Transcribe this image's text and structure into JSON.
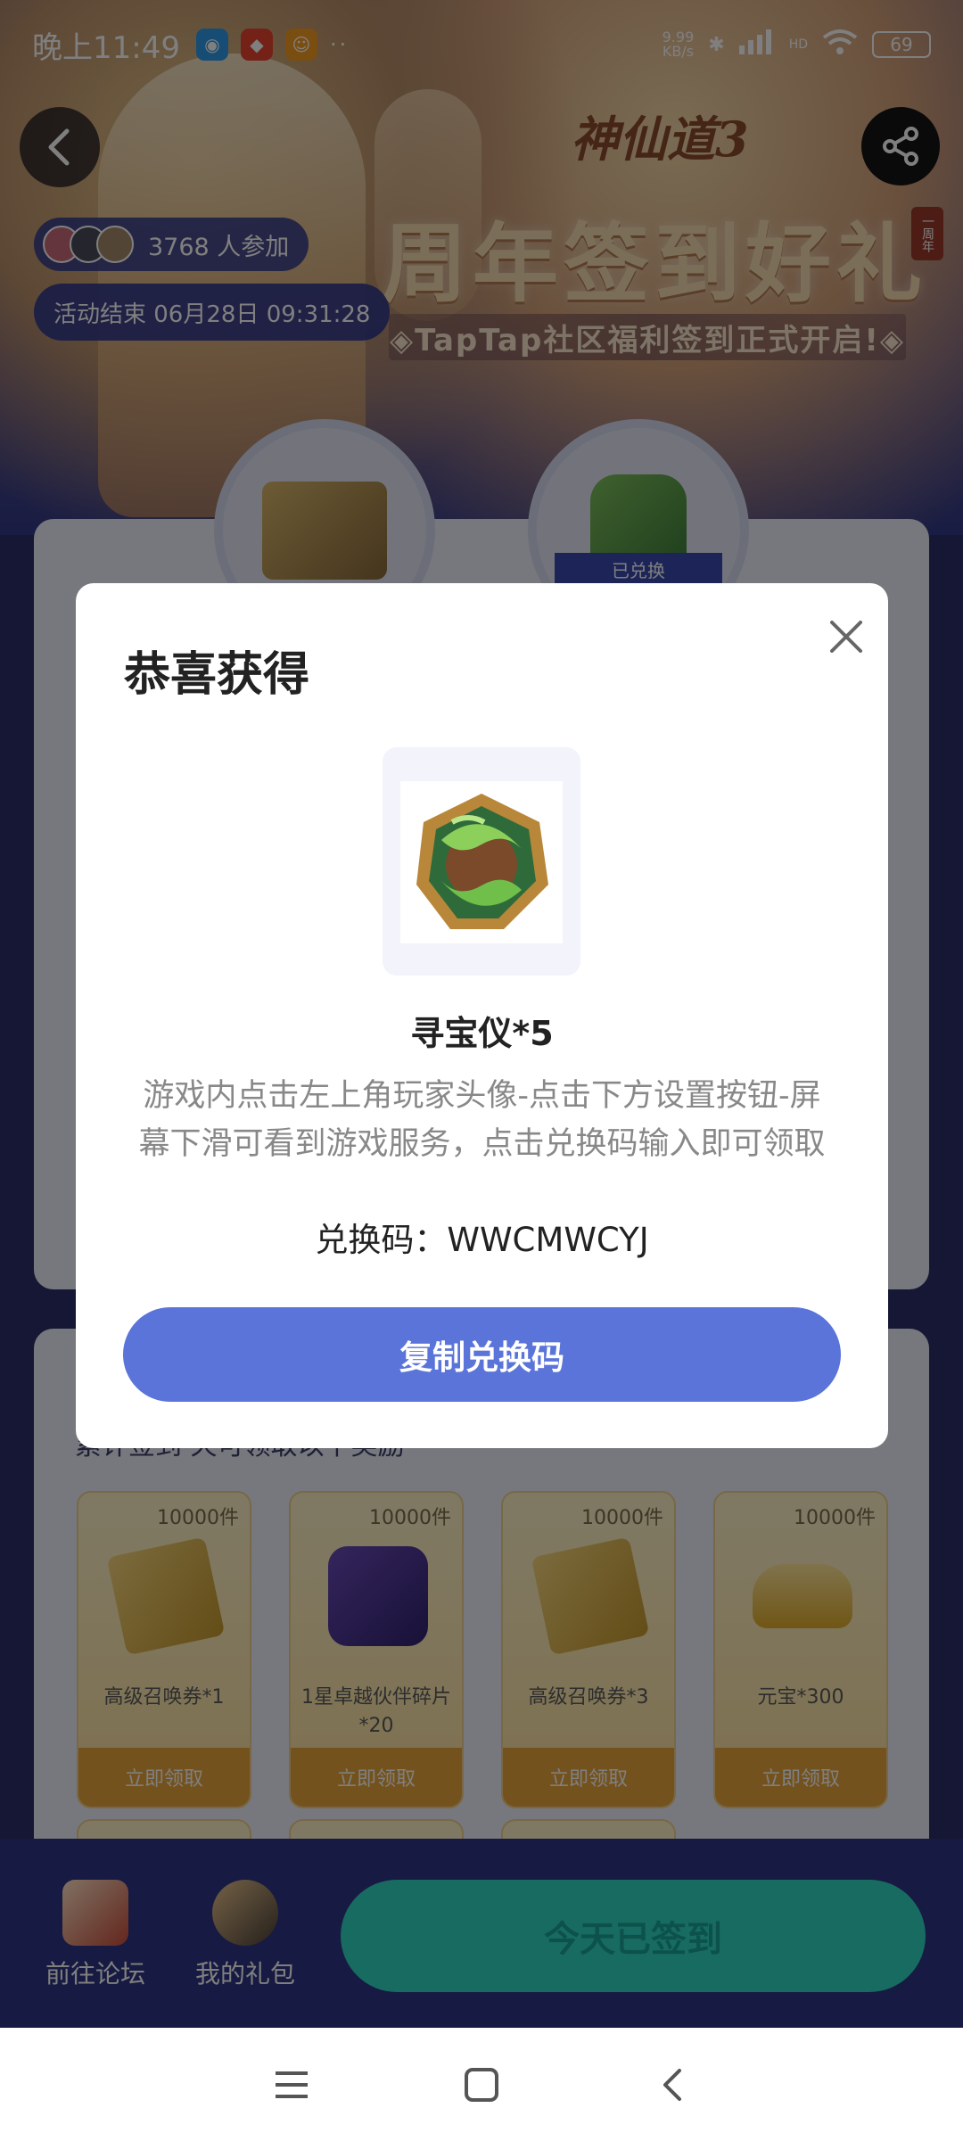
{
  "status_bar": {
    "time": "晚上11:49",
    "more": "··",
    "net_speed_value": "9.99",
    "net_speed_unit": "KB/s",
    "hd": "HD",
    "battery": "69"
  },
  "hero": {
    "logo": "神仙道3",
    "title": "周年签到好礼",
    "badge": "一周年",
    "subtitle": "◈TapTap社区福利签到正式开启!◈"
  },
  "participants": {
    "text": "3768 人参加"
  },
  "end_time": {
    "text": "活动结束 06月28日 09:31:28"
  },
  "reward_band": "已兑换",
  "hint": "累计签到  天可领取以下奖励",
  "tiles": [
    {
      "count": "10000件",
      "name": "高级召唤券*1",
      "button": "立即领取"
    },
    {
      "count": "10000件",
      "name": "1星卓越伙伴碎片*20",
      "button": "立即领取"
    },
    {
      "count": "10000件",
      "name": "高级召唤券*3",
      "button": "立即领取"
    },
    {
      "count": "10000件",
      "name": "元宝*300",
      "button": "立即领取"
    }
  ],
  "bottom_bar": {
    "forum_label": "前往论坛",
    "gift_label": "我的礼包",
    "checkin_label": "今天已签到"
  },
  "modal": {
    "title": "恭喜获得",
    "prize_name": "寻宝仪*5",
    "prize_desc": "游戏内点击左上角玩家头像-点击下方设置按钮-屏幕下滑可看到游戏服务，点击兑换码输入即可领取",
    "code_label": "兑换码：",
    "code_value": "WWCMWCYJ",
    "copy_button": "复制兑换码"
  },
  "colors": {
    "accent": "#5b74da",
    "checkin": "#2fd6c3",
    "claim": "#e8a43a"
  }
}
